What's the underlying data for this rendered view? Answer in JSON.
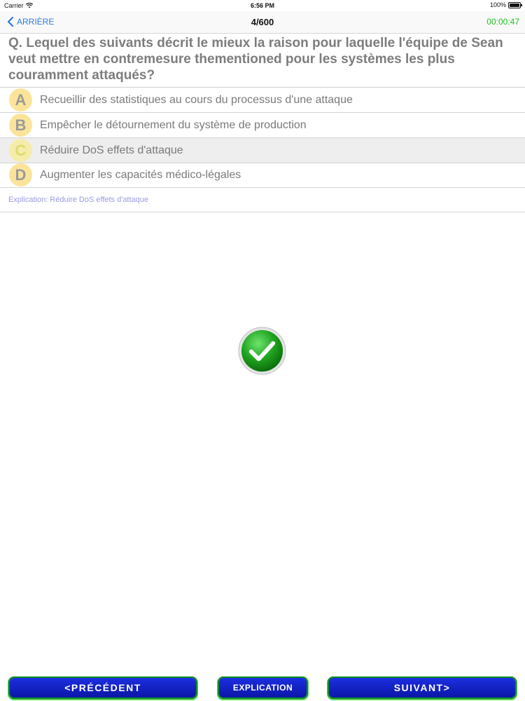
{
  "status_bar": {
    "carrier": "Carrier",
    "time": "6:56 PM",
    "battery": "100%"
  },
  "nav": {
    "back_label": "ARRIÈRE",
    "title": "4/600",
    "timer": "00:00:47"
  },
  "question": {
    "text": "Q. Lequel des suivants décrit le mieux la raison pour laquelle l'équipe de Sean veut mettre en contremesure thementioned pour les systèmes les plus couramment attaqués?"
  },
  "answers": [
    {
      "letter": "A",
      "text": "Recueillir des statistiques au cours du processus d'une attaque"
    },
    {
      "letter": "B",
      "text": "Empêcher le détournement du système de production"
    },
    {
      "letter": "C",
      "text": "Réduire DoS effets d'attaque"
    },
    {
      "letter": "D",
      "text": "Augmenter les capacités médico-légales"
    }
  ],
  "explanation": {
    "text": "Explication: Réduire DoS effets d'attaque"
  },
  "buttons": {
    "previous": "<PRÉCÉDENT",
    "explanation": "EXPLICATION",
    "next": "SUIVANT>"
  },
  "colors": {
    "accent": "#2a7ae2",
    "timer": "#1ec21e",
    "button_fill": "#1226d0",
    "button_border": "#0d8f1e",
    "check_green": "#1fa51f"
  }
}
